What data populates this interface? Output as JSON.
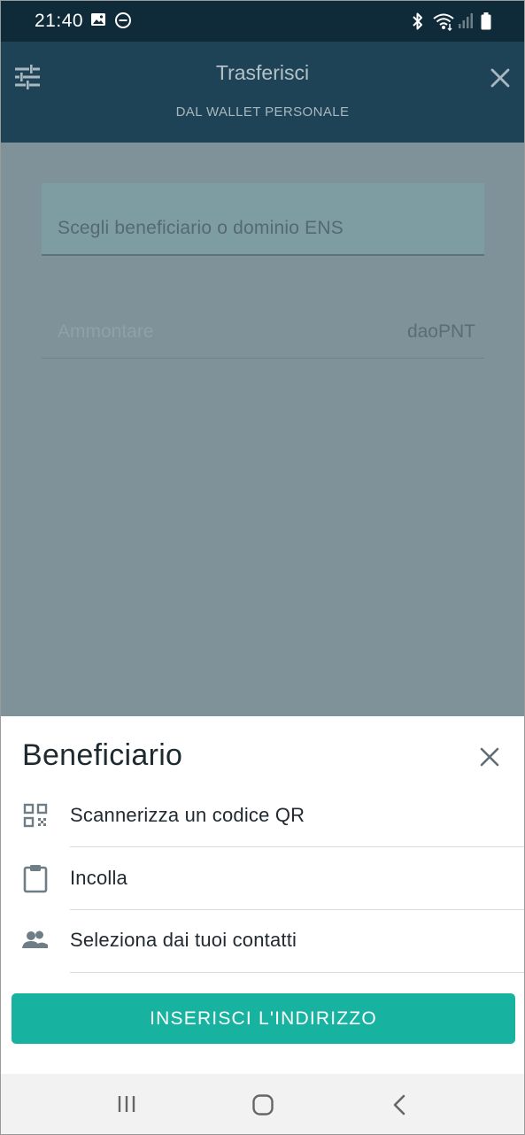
{
  "status_bar": {
    "time": "21:40"
  },
  "header": {
    "title": "Trasferisci",
    "subtitle": "DAL WALLET PERSONALE"
  },
  "form": {
    "recipient_placeholder": "Scegli beneficiario o dominio ENS",
    "amount_placeholder": "Ammontare",
    "amount_unit": "daoPNT"
  },
  "sheet": {
    "title": "Beneficiario",
    "options": [
      {
        "label": "Scannerizza un codice QR",
        "icon": "qr-code-icon"
      },
      {
        "label": "Incolla",
        "icon": "clipboard-icon"
      },
      {
        "label": "Seleziona dai tuoi contatti",
        "icon": "contacts-icon"
      }
    ],
    "cta_label": "INSERISCI L'INDIRIZZO"
  },
  "colors": {
    "status_bar": "#0f2a38",
    "app_bar": "#1f4356",
    "overlay": "#7f9199",
    "accent": "#17b3a0"
  }
}
